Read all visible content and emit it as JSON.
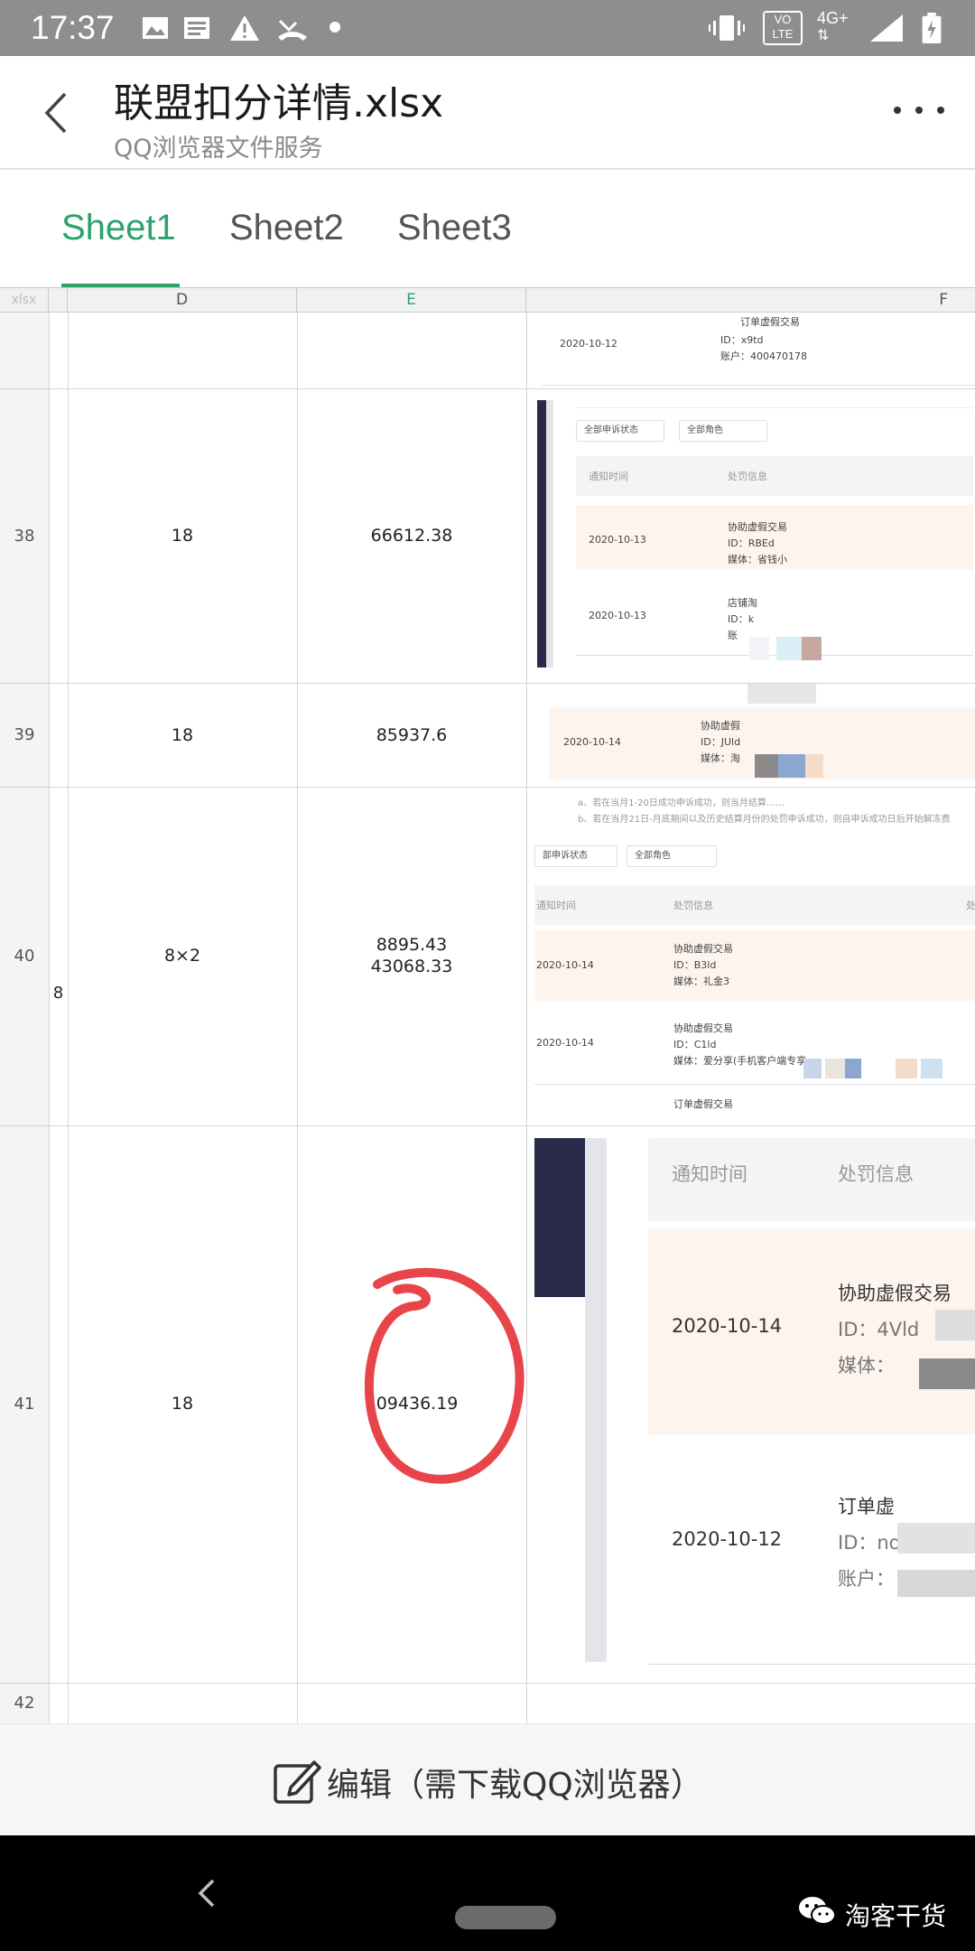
{
  "status_bar": {
    "time": "17:37",
    "volte_top": "VO",
    "volte_bottom": "LTE",
    "network": "4G+"
  },
  "header": {
    "title": "联盟扣分详情.xlsx",
    "subtitle": "QQ浏览器文件服务"
  },
  "tabs": [
    "Sheet1",
    "Sheet2",
    "Sheet3"
  ],
  "active_tab": 0,
  "sheet": {
    "corner_label": "xlsx",
    "columns": [
      "D",
      "E",
      "F"
    ],
    "rows": [
      {
        "num": "38",
        "d": "18",
        "e": "66612.38"
      },
      {
        "num": "39",
        "d": "18",
        "e": "85937.6"
      },
      {
        "num": "40",
        "d": "8×2",
        "e": "8895.43",
        "e2": "43068.33",
        "c_fragment": "8"
      },
      {
        "num": "41",
        "d": "18",
        "e": "109436.19"
      },
      {
        "num": "42",
        "d": "",
        "e": ""
      }
    ]
  },
  "screenshots": {
    "top": {
      "date": "2020-10-12",
      "line1": "订单虚假交易",
      "id": "ID：x9td",
      "account": "账户：400470178"
    },
    "r38": {
      "filter1": "全部申诉状态",
      "filter2": "全部角色",
      "h_time": "通知时间",
      "h_info": "处罚信息",
      "date1": "2020-10-13",
      "t1": "协助虚假交易",
      "id1": "ID：RBEd",
      "m1": "媒体：省钱小",
      "date2": "2020-10-13",
      "t2": "店铺淘",
      "id2": "ID：k",
      "m2": "账"
    },
    "r39": {
      "date": "2020-10-14",
      "t": "协助虚假",
      "id": "ID：JUld",
      "m": "媒体：淘"
    },
    "r40": {
      "note1": "a、若在当月1-20日成功申诉成功，则当月结算……",
      "note2": "b、若在当月21日-月底期间以及历史结算月份的处罚申诉成功，则自申诉成功日后开始解冻费",
      "filter1": "部申诉状态",
      "filter2": "全部角色",
      "h_time": "通知时间",
      "h_info": "处罚信息",
      "h_tail": "处",
      "date1": "2020-10-14",
      "t1": "协助虚假交易",
      "id1": "ID：B3ld",
      "m1": "媒体：礼金3",
      "date2": "2020-10-14",
      "t2": "协助虚假交易",
      "id2": "ID：C1ld",
      "m2": "媒体：爱分享(手机客户端专享",
      "t3": "订单虚假交易"
    },
    "r41": {
      "h_time": "通知时间",
      "h_info": "处罚信息",
      "date1": "2020-10-14",
      "t1": "协助虚假交易",
      "id1": "ID：4Vld",
      "m1": "媒体：",
      "date2": "2020-10-12",
      "t2": "订单虚",
      "id2": "ID：no",
      "m2": "账户："
    }
  },
  "edit_bar": {
    "label": "编辑（需下载QQ浏览器）"
  },
  "watermark": "淘客干货",
  "colors": {
    "accent": "#2ba36b",
    "annotation": "#e8454b"
  }
}
